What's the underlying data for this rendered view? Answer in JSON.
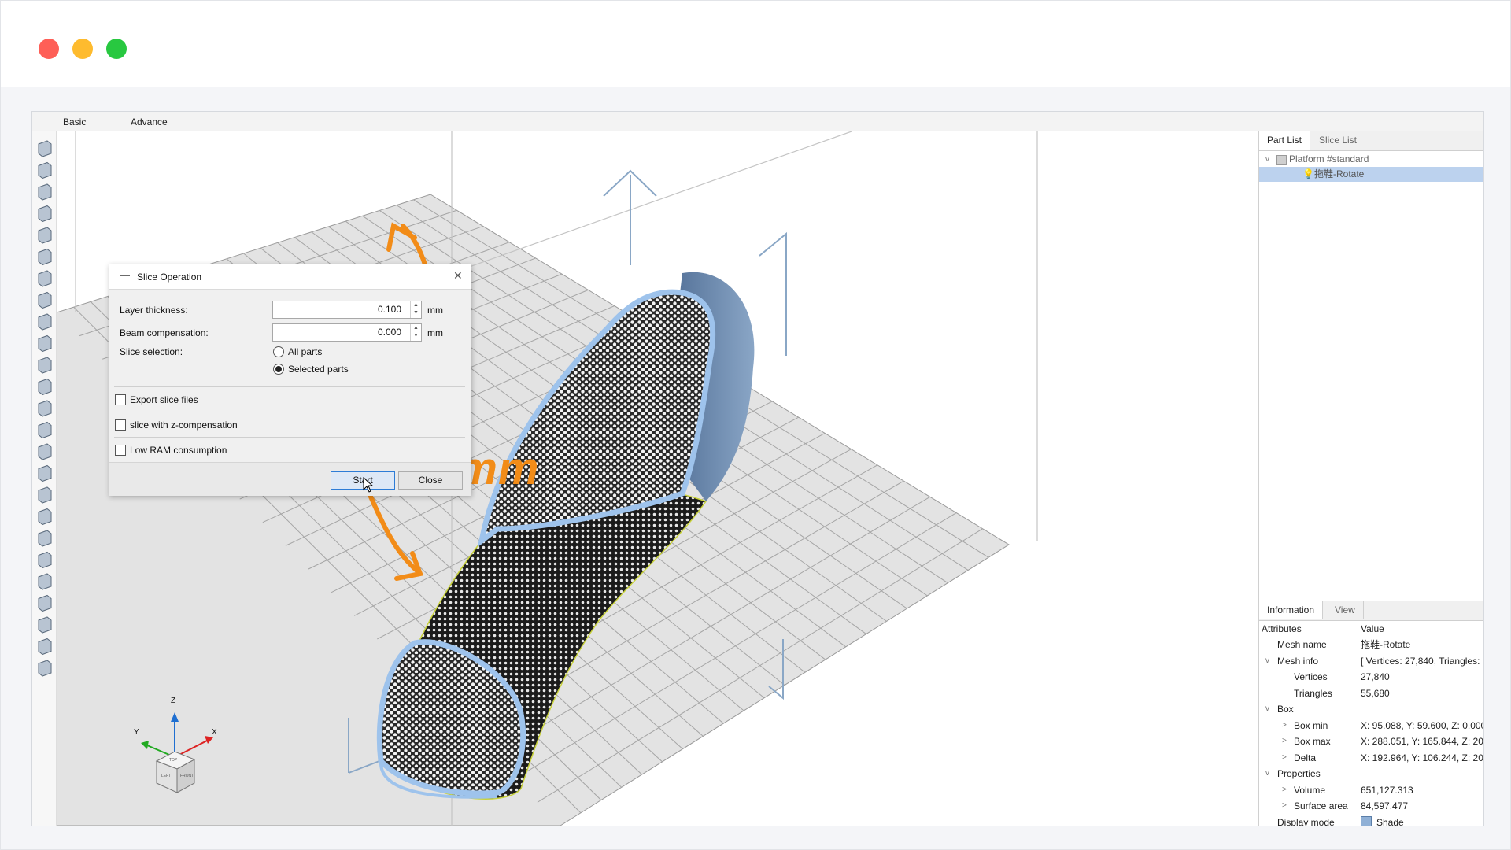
{
  "window": {
    "traffic_lights": {
      "close": "#fe5f57",
      "minimize": "#febb2e",
      "maximize": "#28c840"
    }
  },
  "tabs": [
    {
      "label": "Basic"
    },
    {
      "label": "Advance"
    }
  ],
  "toolbar": {
    "icons": [
      "cube-front-icon",
      "cube-back-icon",
      "cube-left-icon",
      "cube-right-icon",
      "cube-top-icon",
      "cube-bottom-icon",
      "cube-iso-icon",
      "zoom-fit-icon",
      "zoom-selected-icon",
      "zoom-window-icon",
      "zoom-icon",
      "arrow-left-icon",
      "square-icon",
      "plane-icon",
      "rotate-icon",
      "box-icon",
      "shell-icon",
      "hexagon-icon",
      "sphere-icon",
      "triangle-tool-icon",
      "move-icon",
      "scale-icon",
      "cut-icon",
      "mirror-icon",
      "hollow-icon"
    ]
  },
  "dialog": {
    "title": "Slice Operation",
    "layer_thickness": {
      "label": "Layer thickness:",
      "value": "0.100",
      "unit": "mm"
    },
    "beam_compensation": {
      "label": "Beam compensation:",
      "value": "0.000",
      "unit": "mm"
    },
    "slice_selection": {
      "label": "Slice selection:",
      "options": [
        {
          "label": "All parts",
          "selected": false
        },
        {
          "label": "Selected parts",
          "selected": true
        }
      ]
    },
    "checkboxes": [
      {
        "label": "Export slice files",
        "checked": false
      },
      {
        "label": "slice with z-compensation",
        "checked": false
      },
      {
        "label": "Low RAM consumption",
        "checked": false
      }
    ],
    "start_label": "Start",
    "close_label": "Close"
  },
  "overlay": {
    "accuracy_text": "Accuracy: 0.1 mm",
    "color": "#f28c18"
  },
  "axes": {
    "z": "Z",
    "x": "X",
    "y": "Y",
    "cube_top": "TOP",
    "cube_left": "LEFT",
    "cube_front": "FRONT"
  },
  "right_panel": {
    "top_tabs": [
      {
        "label": "Part List",
        "active": true
      },
      {
        "label": "Slice List",
        "active": false
      }
    ],
    "tree": {
      "platform": "Platform #standard",
      "part": "拖鞋-Rotate"
    },
    "info_tabs": [
      {
        "label": "Information",
        "active": true
      },
      {
        "label": "View",
        "active": false
      }
    ],
    "attributes_header": {
      "key": "Attributes",
      "value": "Value"
    },
    "attributes": [
      {
        "key": "Mesh name",
        "value": "拖鞋-Rotate",
        "level": 0,
        "caret": ""
      },
      {
        "key": "Mesh info",
        "value": "[ Vertices: 27,840, Triangles:",
        "level": 0,
        "caret": "v"
      },
      {
        "key": "Vertices",
        "value": "27,840",
        "level": 1,
        "caret": ""
      },
      {
        "key": "Triangles",
        "value": "55,680",
        "level": 1,
        "caret": ""
      },
      {
        "key": "Box",
        "value": "",
        "level": 0,
        "caret": "v"
      },
      {
        "key": "Box min",
        "value": "X: 95.088, Y: 59.600, Z: 0.000",
        "level": 1,
        "caret": ">"
      },
      {
        "key": "Box max",
        "value": "X: 288.051, Y: 165.844, Z: 20",
        "level": 1,
        "caret": ">"
      },
      {
        "key": "Delta",
        "value": "X: 192.964, Y: 106.244, Z: 20",
        "level": 1,
        "caret": ">"
      },
      {
        "key": "Properties",
        "value": "",
        "level": 0,
        "caret": "v"
      },
      {
        "key": "Volume",
        "value": "651,127.313",
        "level": 1,
        "caret": ">"
      },
      {
        "key": "Surface area",
        "value": "84,597.477",
        "level": 1,
        "caret": ">"
      },
      {
        "key": "Display mode",
        "value": "Shade",
        "level": 0,
        "caret": ""
      }
    ]
  }
}
